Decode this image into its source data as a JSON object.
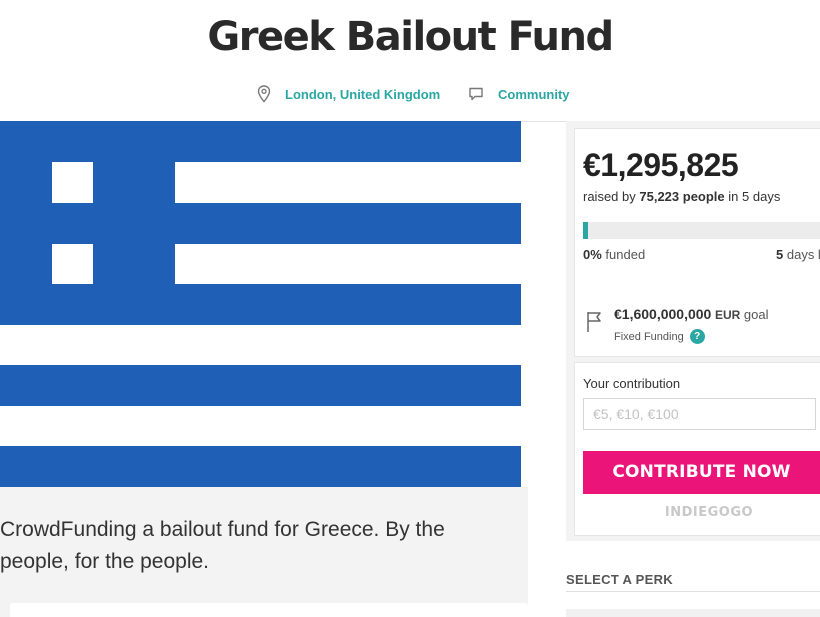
{
  "header": {
    "title": "Greek Bailout Fund",
    "location": "London, United Kingdom",
    "category": "Community",
    "location_icon": "map-pin-icon",
    "category_icon": "speech-bubble-icon"
  },
  "description": "CrowdFunding a bailout fund for Greece. By the people, for the people.",
  "campaign": {
    "amount_raised": "€1,295,825",
    "raised_prefix": "raised by",
    "backers": "75,223 people",
    "raised_suffix": "in 5 days",
    "funded_pct": "0%",
    "funded_label": "funded",
    "progress_fraction": 0.02,
    "days_left_value": "5",
    "days_left_label": "days l",
    "goal_amount": "€1,600,000,000",
    "goal_currency": "EUR",
    "goal_label": "goal",
    "funding_type": "Fixed Funding",
    "help_glyph": "?"
  },
  "contribute": {
    "label": "Your contribution",
    "placeholder": "€5, €10, €100",
    "button_label": "CONTRIBUTE NOW",
    "brand": "INDIEGOGO"
  },
  "perks": {
    "title": "SELECT A PERK"
  },
  "colors": {
    "accent_teal": "#2aa6a3",
    "button_pink": "#eb1478",
    "flag_blue": "#1f5fb5"
  }
}
